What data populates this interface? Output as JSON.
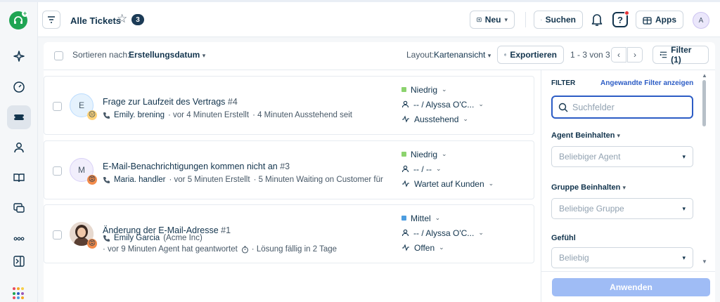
{
  "header": {
    "title": "Alle Tickets",
    "count": "3",
    "new_label": "Neu",
    "search_label": "Suchen",
    "apps_label": "Apps",
    "avatar_initial": "A"
  },
  "toolbar": {
    "sort_label": "Sortieren nach:",
    "sort_value": "Erstellungsdatum",
    "layout_label": "Layout:",
    "layout_value": "Kartenansicht",
    "export_label": "Exportieren",
    "pager_text": "1 - 3 von 3",
    "filter_label": "Filter (1)"
  },
  "tickets": [
    {
      "avatar": "E",
      "avatar_bg": "#e5f2fd",
      "avatar_border": "#bbdcfe",
      "emoji": "😐",
      "emoji_bg": "#ffd37a",
      "title": "Frage zur Laufzeit des Vertrags",
      "number": "#4",
      "requester": "Emily. brening",
      "company": "",
      "meta1": "· vor 4 Minuten Erstellt",
      "meta2": "·   4 Minuten Ausstehend seit",
      "priority": "Niedrig",
      "priority_color": "#8cd36e",
      "agent": "-- / Alyssa O'C...",
      "status": "Ausstehend"
    },
    {
      "avatar": "M",
      "avatar_bg": "#f1eefc",
      "avatar_border": "#d9d1f7",
      "emoji": "😡",
      "emoji_bg": "#f28b4b",
      "title": "E-Mail-Benachrichtigungen kommen nicht an",
      "number": "#3",
      "requester": "Maria. handler",
      "company": "",
      "meta1": "· vor 5 Minuten Erstellt",
      "meta2": "·   5 Minuten Waiting on Customer für",
      "priority": "Niedrig",
      "priority_color": "#8cd36e",
      "agent": "-- / --",
      "status": "Wartet auf Kunden"
    },
    {
      "avatar": "",
      "avatar_bg": "#7a5b4a",
      "avatar_border": "#7a5b4a",
      "emoji": "😡",
      "emoji_bg": "#f28b4b",
      "title": "Änderung der E-Mail-Adresse",
      "number": "#1",
      "requester": "Emily Garcia",
      "company": "(Acme Inc)",
      "meta1": "· vor 9 Minuten Agent hat geantwortet",
      "meta2": "·   Lösung fällig in 2 Tage",
      "priority": "Mittel",
      "priority_color": "#4d9de0",
      "agent": "-- / Alyssa O'C...",
      "status": "Offen"
    }
  ],
  "filter_panel": {
    "title": "FILTER",
    "applied_link": "Angewandte Filter anzeigen",
    "search_placeholder": "Suchfelder",
    "agent_label": "Agent Beinhalten",
    "agent_placeholder": "Beliebiger Agent",
    "group_label": "Gruppe Beinhalten",
    "group_placeholder": "Beliebige Gruppe",
    "sentiment_label": "Gefühl",
    "sentiment_placeholder": "Beliebig",
    "apply_label": "Anwenden"
  },
  "colors": {
    "brand": "#1fa453",
    "primary": "#2c5cc5",
    "apply_disabled": "#9fbcf5"
  }
}
